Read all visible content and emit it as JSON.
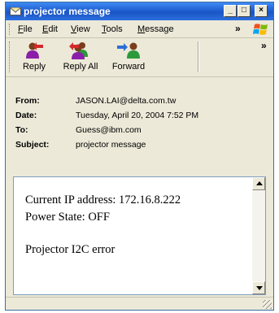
{
  "window": {
    "title": "projector message",
    "controls": {
      "minimize": "_",
      "maximize": "□",
      "close": "×"
    }
  },
  "menubar": {
    "items": [
      {
        "label": "File",
        "accel": "F",
        "rest": "ile"
      },
      {
        "label": "Edit",
        "accel": "E",
        "rest": "dit"
      },
      {
        "label": "View",
        "accel": "V",
        "rest": "iew"
      },
      {
        "label": "Tools",
        "accel": "T",
        "rest": "ools"
      },
      {
        "label": "Message",
        "accel": "M",
        "rest": "essage"
      }
    ],
    "overflow": "»"
  },
  "toolbar": {
    "buttons": [
      {
        "label": "Reply",
        "icon": "reply-icon"
      },
      {
        "label": "Reply All",
        "icon": "reply-all-icon"
      },
      {
        "label": "Forward",
        "icon": "forward-icon"
      }
    ],
    "overflow": "»"
  },
  "header": {
    "from_label": "From:",
    "from_value": "JASON.LAI@delta.com.tw",
    "date_label": "Date:",
    "date_value": "Tuesday, April 20, 2004 7:52 PM",
    "to_label": "To:",
    "to_value": "Guess@ibm.com",
    "subject_label": "Subject:",
    "subject_value": "projector message"
  },
  "body": {
    "lines": [
      "Current IP address: 172.16.8.222",
      "Power State: OFF",
      "",
      "Projector I2C error"
    ]
  },
  "colors": {
    "titlebar": "#1f5fd2",
    "window_bg": "#ece9d8",
    "body_border": "#7f9db9"
  }
}
